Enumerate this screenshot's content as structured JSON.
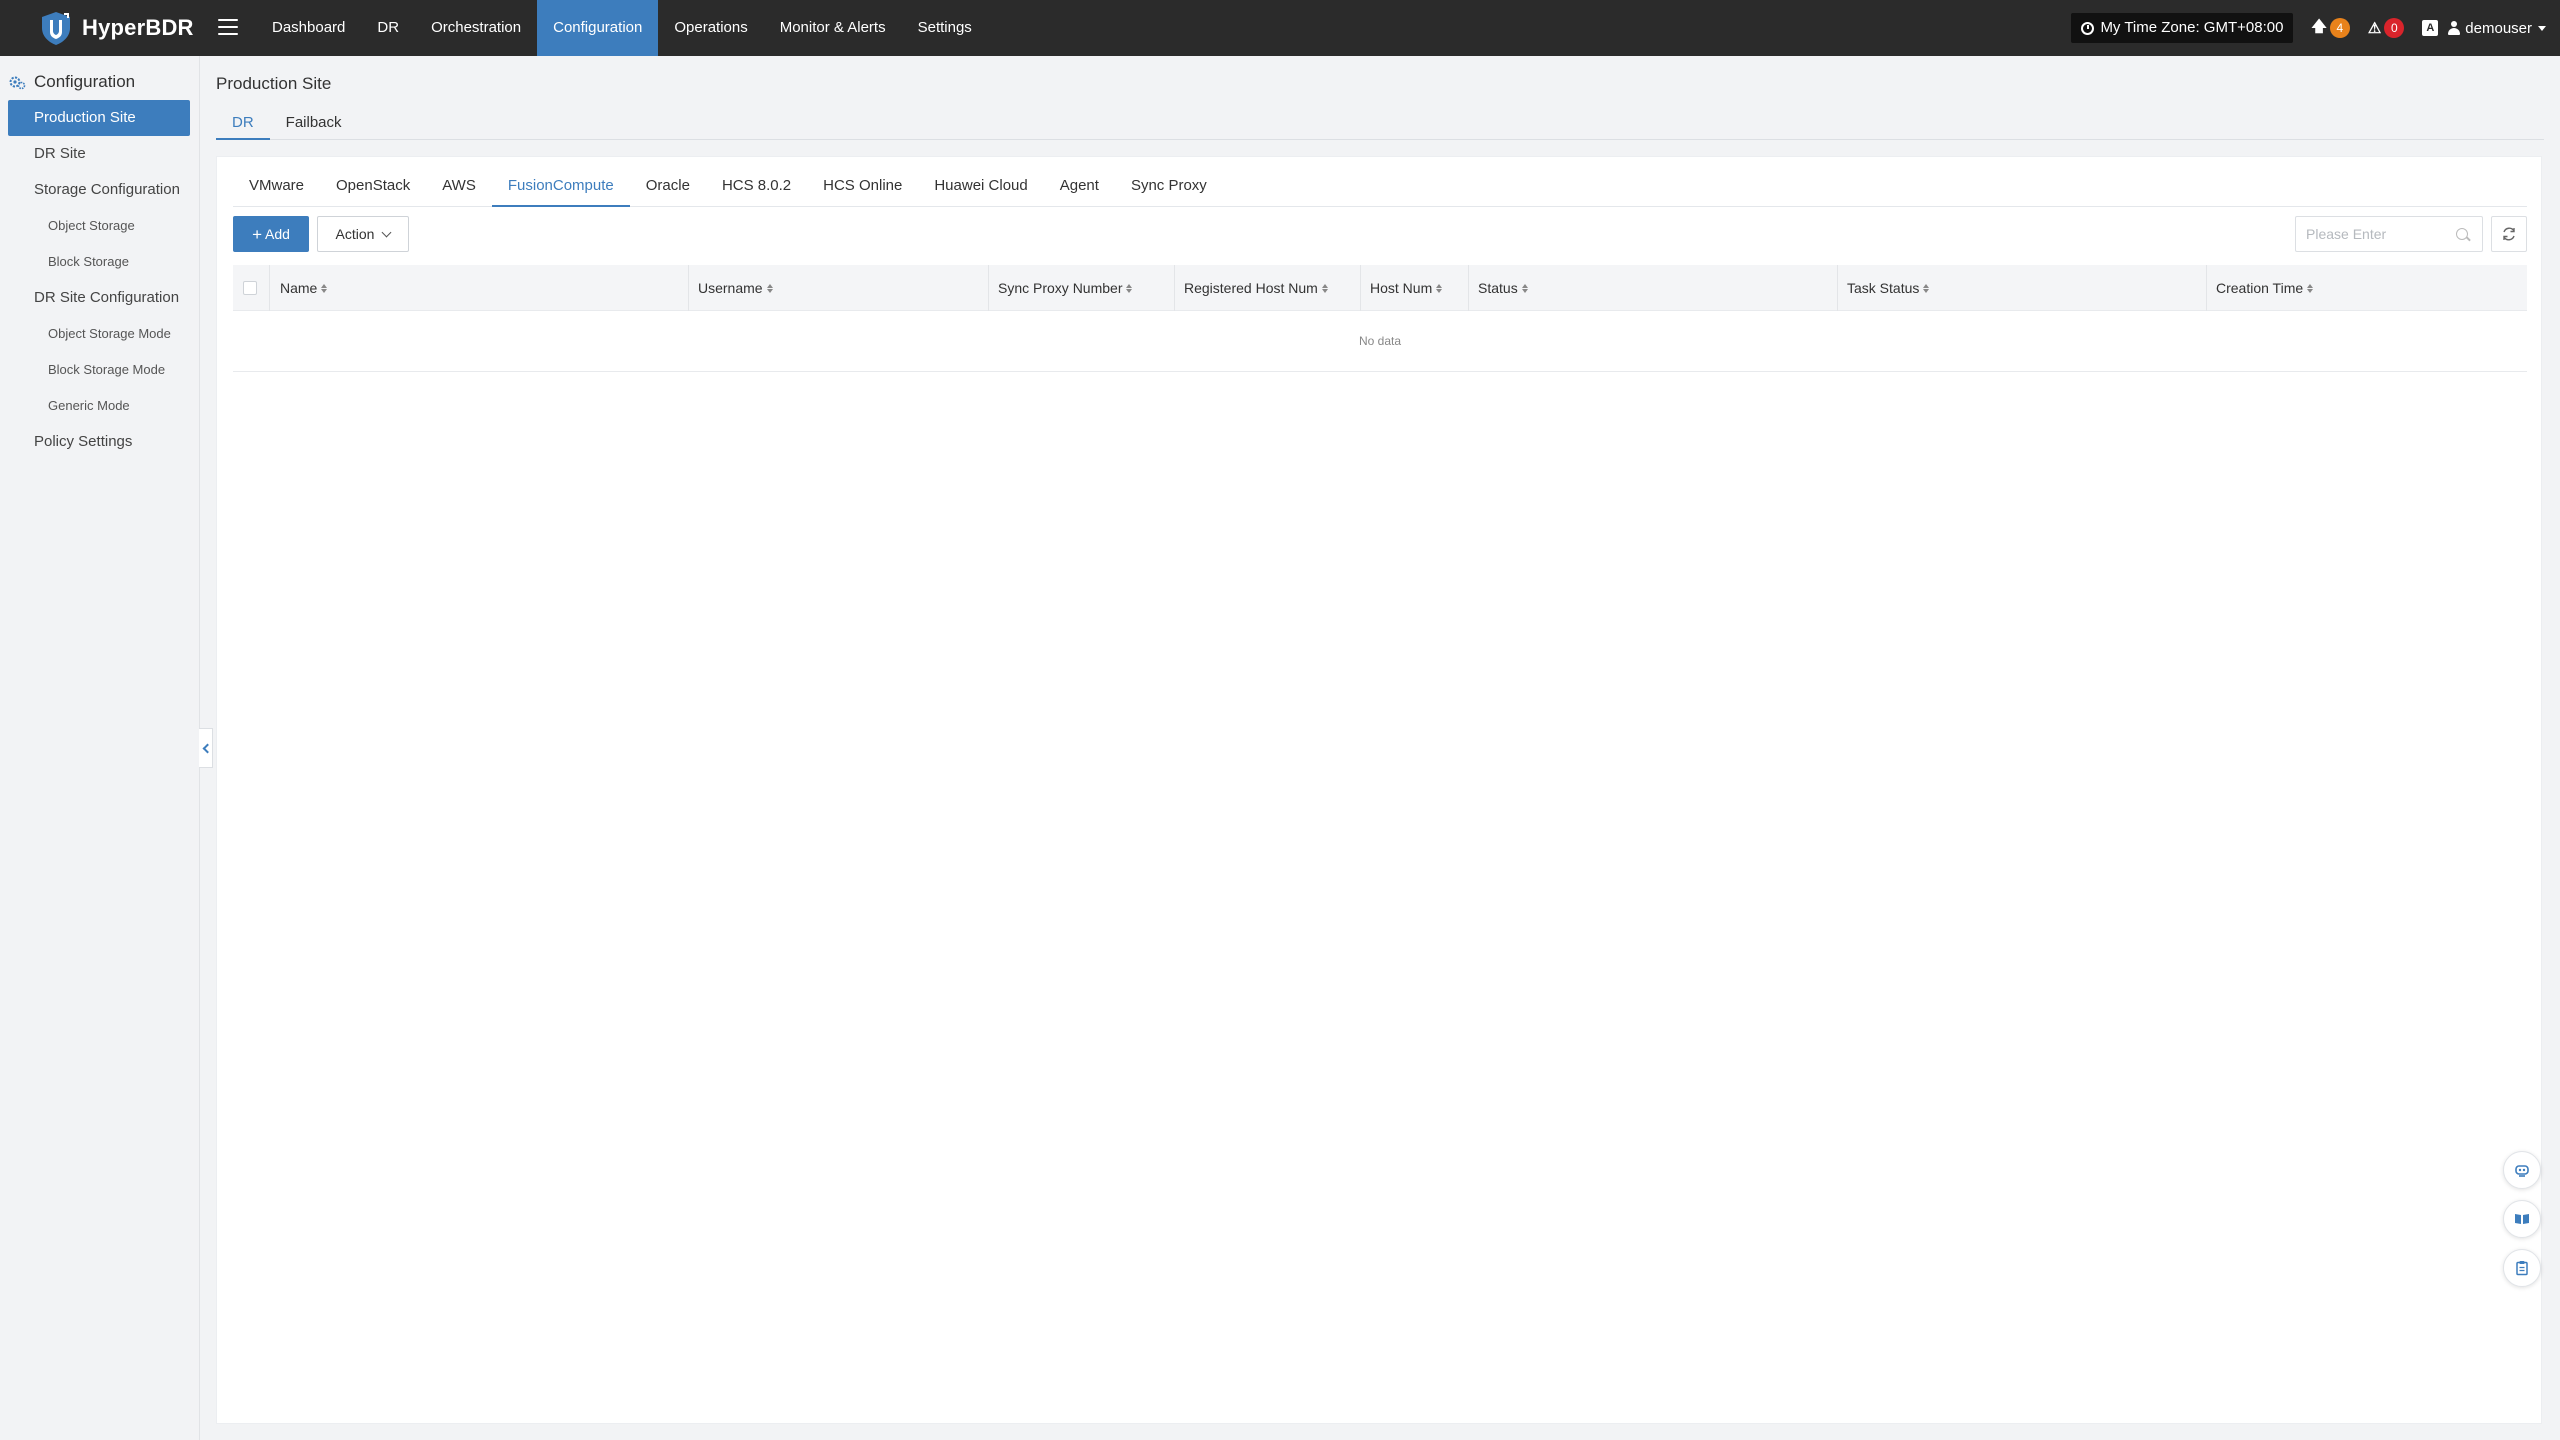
{
  "app": {
    "name": "HyperBDR",
    "nav": [
      {
        "label": "Dashboard",
        "active": false
      },
      {
        "label": "DR",
        "active": false
      },
      {
        "label": "Orchestration",
        "active": false
      },
      {
        "label": "Configuration",
        "active": true
      },
      {
        "label": "Operations",
        "active": false
      },
      {
        "label": "Monitor & Alerts",
        "active": false
      },
      {
        "label": "Settings",
        "active": false
      }
    ],
    "timezone": "My Time Zone: GMT+08:00",
    "upload_count": "4",
    "alert_count": "0",
    "user": "demouser",
    "colors": {
      "accent": "#3d7dbd",
      "topbar": "#2b2b2b",
      "upload_badge": "#e8821b",
      "alert_badge": "#d9242b"
    }
  },
  "sidebar": {
    "title": "Configuration",
    "items": [
      {
        "label": "Production Site",
        "active": true,
        "level": 1
      },
      {
        "label": "DR Site",
        "active": false,
        "level": 1
      },
      {
        "label": "Storage Configuration",
        "active": false,
        "level": 1
      },
      {
        "label": "Object Storage",
        "active": false,
        "level": 2
      },
      {
        "label": "Block Storage",
        "active": false,
        "level": 2
      },
      {
        "label": "DR Site Configuration",
        "active": false,
        "level": 1
      },
      {
        "label": "Object Storage Mode",
        "active": false,
        "level": 2
      },
      {
        "label": "Block Storage Mode",
        "active": false,
        "level": 2
      },
      {
        "label": "Generic Mode",
        "active": false,
        "level": 2
      },
      {
        "label": "Policy Settings",
        "active": false,
        "level": 1
      }
    ]
  },
  "main": {
    "title": "Production Site",
    "sub_tabs": [
      {
        "label": "DR",
        "active": true
      },
      {
        "label": "Failback",
        "active": false
      }
    ],
    "platform_tabs": [
      {
        "label": "VMware",
        "active": false
      },
      {
        "label": "OpenStack",
        "active": false
      },
      {
        "label": "AWS",
        "active": false
      },
      {
        "label": "FusionCompute",
        "active": true
      },
      {
        "label": "Oracle",
        "active": false
      },
      {
        "label": "HCS 8.0.2",
        "active": false
      },
      {
        "label": "HCS Online",
        "active": false
      },
      {
        "label": "Huawei Cloud",
        "active": false
      },
      {
        "label": "Agent",
        "active": false
      },
      {
        "label": "Sync Proxy",
        "active": false
      }
    ],
    "toolbar": {
      "add_label": "Add",
      "action_label": "Action",
      "search_placeholder": "Please Enter"
    },
    "table": {
      "columns": [
        "Name",
        "Username",
        "Sync Proxy Number",
        "Registered Host Num",
        "Host Num",
        "Status",
        "Task Status",
        "Creation Time"
      ],
      "rows": [],
      "empty_text": "No data"
    }
  },
  "float_buttons": [
    "robot-assistant-icon",
    "manual-book-icon",
    "clipboard-icon"
  ]
}
